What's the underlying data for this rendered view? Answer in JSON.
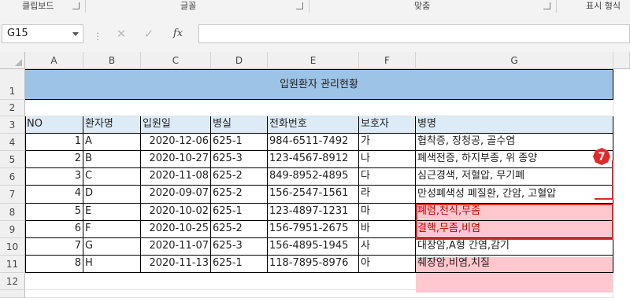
{
  "ribbon_groups": [
    "클립보드",
    "글꼴",
    "맞춤",
    "표시 형식"
  ],
  "formula_bar": {
    "cell_ref": "G15",
    "formula": ""
  },
  "columns": [
    "A",
    "B",
    "C",
    "D",
    "E",
    "F",
    "G"
  ],
  "row_numbers": [
    "1",
    "2",
    "3",
    "4",
    "5",
    "6",
    "7",
    "8",
    "9",
    "10",
    "11",
    "12"
  ],
  "sheet": {
    "title": "입원환자 관리현황",
    "headers": [
      "NO",
      "환자명",
      "입원일",
      "병실",
      "전화번호",
      "보호자",
      "병명"
    ],
    "rows": [
      {
        "no": "1",
        "name": "A",
        "date": "2020-12-06",
        "room": "625-1",
        "phone": "984-6511-7492",
        "guardian": "가",
        "disease": "협착증, 장청공, 골수염"
      },
      {
        "no": "2",
        "name": "B",
        "date": "2020-10-27",
        "room": "625-3",
        "phone": "123-4567-8912",
        "guardian": "나",
        "disease": "폐색전증, 하지부종, 위 종양"
      },
      {
        "no": "3",
        "name": "C",
        "date": "2020-11-08",
        "room": "625-2",
        "phone": "849-8952-4895",
        "guardian": "다",
        "disease": "심근경색, 저혈압, 무기폐"
      },
      {
        "no": "4",
        "name": "D",
        "date": "2020-09-07",
        "room": "625-2",
        "phone": "156-2547-1561",
        "guardian": "라",
        "disease": "만성폐색성 폐질환, 간암, 고혈압"
      },
      {
        "no": "5",
        "name": "E",
        "date": "2020-10-02",
        "room": "625-1",
        "phone": "123-4897-1231",
        "guardian": "마",
        "disease": "폐렴,천식,무좀"
      },
      {
        "no": "6",
        "name": "F",
        "date": "2020-10-25",
        "room": "625-2",
        "phone": "156-7951-2675",
        "guardian": "바",
        "disease": "결핵,무좀,비염"
      },
      {
        "no": "7",
        "name": "G",
        "date": "2020-11-07",
        "room": "625-3",
        "phone": "156-4895-1945",
        "guardian": "사",
        "disease": "대장암,A형 간염,감기"
      },
      {
        "no": "8",
        "name": "H",
        "date": "2020-11-13",
        "room": "625-1",
        "phone": "118-7895-8976",
        "guardian": "아",
        "disease": "췌장암,비염,치질"
      }
    ]
  },
  "annotation": {
    "number": "7",
    "color": "#e02a2a"
  },
  "colors": {
    "title_fill": "#9dc3e6",
    "header_fill": "#ddebf7",
    "highlight_fill": "#ffc7ce",
    "highlight_text": "#c00000"
  }
}
